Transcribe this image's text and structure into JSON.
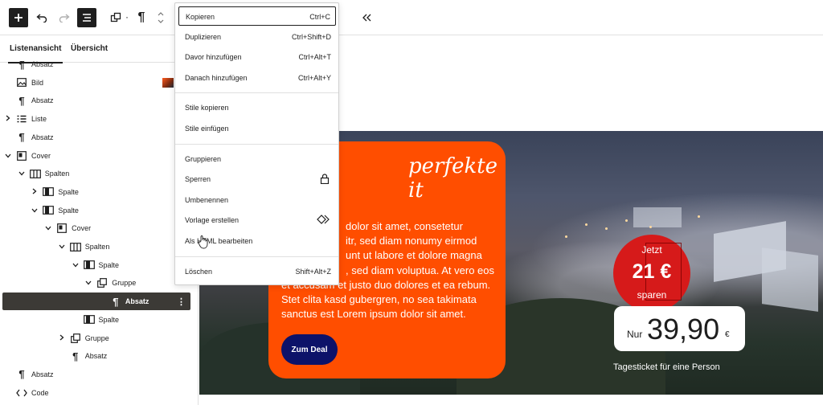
{
  "sidebar": {
    "tabs": [
      "Listenansicht",
      "Übersicht"
    ],
    "tree": [
      {
        "label": "Absatz",
        "icon": "paragraph-icon",
        "indent": 0,
        "chevron": "none"
      },
      {
        "label": "Bild",
        "icon": "image-icon",
        "indent": 0,
        "chevron": "none"
      },
      {
        "label": "Absatz",
        "icon": "paragraph-icon",
        "indent": 0,
        "chevron": "none"
      },
      {
        "label": "Liste",
        "icon": "list-icon",
        "indent": 0,
        "chevron": "right"
      },
      {
        "label": "Absatz",
        "icon": "paragraph-icon",
        "indent": 0,
        "chevron": "none"
      },
      {
        "label": "Cover",
        "icon": "cover-icon",
        "indent": 0,
        "chevron": "down"
      },
      {
        "label": "Spalten",
        "icon": "columns-icon",
        "indent": 1,
        "chevron": "down"
      },
      {
        "label": "Spalte",
        "icon": "column-icon",
        "indent": 2,
        "chevron": "right"
      },
      {
        "label": "Spalte",
        "icon": "column-icon",
        "indent": 2,
        "chevron": "down"
      },
      {
        "label": "Cover",
        "icon": "cover-icon",
        "indent": 3,
        "chevron": "down"
      },
      {
        "label": "Spalten",
        "icon": "columns-icon",
        "indent": 4,
        "chevron": "down"
      },
      {
        "label": "Spalte",
        "icon": "column-icon",
        "indent": 5,
        "chevron": "down"
      },
      {
        "label": "Gruppe",
        "icon": "group-icon",
        "indent": 6,
        "chevron": "down"
      },
      {
        "label": "Absatz",
        "icon": "paragraph-icon",
        "indent": 7,
        "chevron": "none",
        "selected": true
      },
      {
        "label": "Spalte",
        "icon": "column-icon",
        "indent": 5,
        "chevron": "none"
      },
      {
        "label": "Gruppe",
        "icon": "group-icon",
        "indent": 4,
        "chevron": "right"
      },
      {
        "label": "Absatz",
        "icon": "paragraph-icon",
        "indent": 4,
        "chevron": "none"
      },
      {
        "label": "Absatz",
        "icon": "paragraph-icon",
        "indent": 0,
        "chevron": "none"
      },
      {
        "label": "Code",
        "icon": "code-icon",
        "indent": 0,
        "chevron": "none"
      }
    ]
  },
  "menu": {
    "group1": [
      {
        "label": "Kopieren",
        "shortcut": "Ctrl+C"
      },
      {
        "label": "Duplizieren",
        "shortcut": "Ctrl+Shift+D"
      },
      {
        "label": "Davor hinzufügen",
        "shortcut": "Ctrl+Alt+T"
      },
      {
        "label": "Danach hinzufügen",
        "shortcut": "Ctrl+Alt+Y"
      }
    ],
    "group2": [
      {
        "label": "Stile kopieren"
      },
      {
        "label": "Stile einfügen"
      }
    ],
    "group3": [
      {
        "label": "Gruppieren"
      },
      {
        "label": "Sperren",
        "icon": "lock-icon"
      },
      {
        "label": "Umbenennen"
      },
      {
        "label": "Vorlage erstellen",
        "icon": "pattern-icon"
      },
      {
        "label": "Als HTML bearbeiten"
      }
    ],
    "group4": [
      {
        "label": "Löschen",
        "shortcut": "Shift+Alt+Z"
      }
    ]
  },
  "canvas": {
    "heading": "perfekte\nit",
    "paragraph": "dolor sit amet, consetetur\nitr, sed diam nonumy eirmod\nunt ut labore et dolore magna\n, sed diam voluptua. At vero eos\net accusam et justo duo dolores et ea rebum.\nStet clita kasd gubergren, no sea takimata\nsanctus est Lorem ipsum dolor sit amet.",
    "button": "Zum Deal",
    "badge_top": "Jetzt",
    "badge_amount": "21 €",
    "badge_bottom": "sparen",
    "price_prefix": "Nur",
    "price": "39,90",
    "price_currency": "€",
    "ticket": "Tagesticket für eine Person"
  },
  "colors": {
    "accent_orange": "#ff4e00",
    "badge_red": "#d61a1a",
    "button_navy": "#0c1269",
    "selected_row": "#3c3a36"
  }
}
